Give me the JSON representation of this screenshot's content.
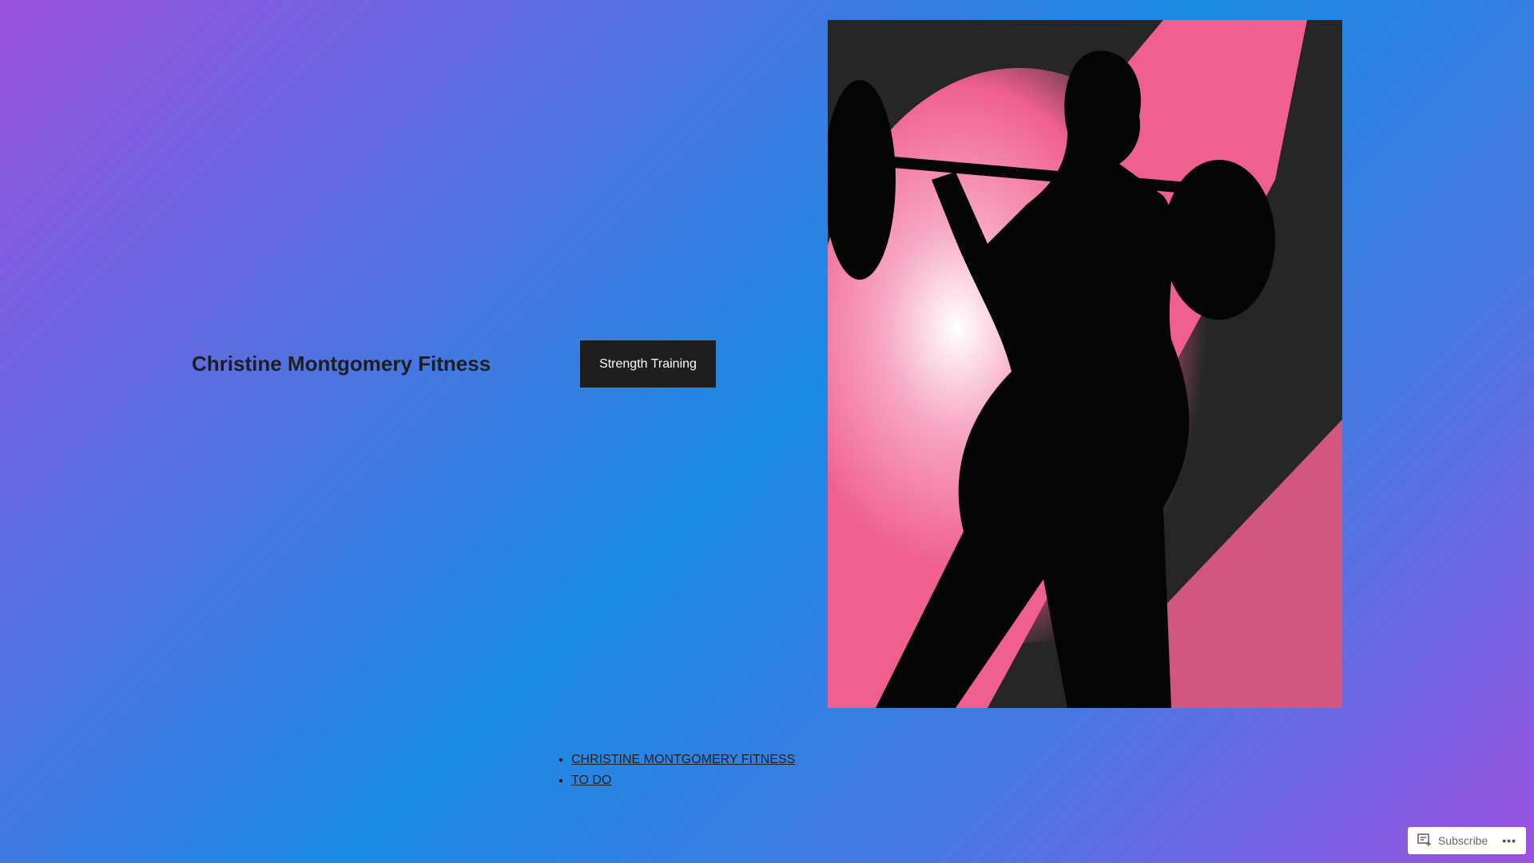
{
  "site": {
    "title": "Christine Montgomery Fitness"
  },
  "nav": {
    "button_label": "Strength Training"
  },
  "hero": {
    "image_alt": "Silhouette of woman lifting a barbell on pink paint background"
  },
  "links": [
    {
      "label": "CHRISTINE MONTGOMERY FITNESS"
    },
    {
      "label": "TO DO"
    }
  ],
  "subscribe": {
    "label": "Subscribe",
    "more": "•••"
  },
  "colors": {
    "pink": "#f0608f",
    "dark": "#1e1e1e"
  }
}
